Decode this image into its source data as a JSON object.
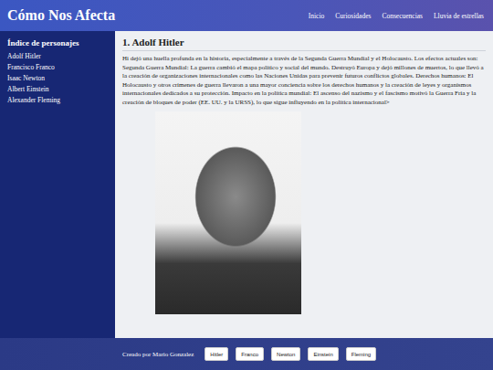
{
  "header": {
    "title": "Cómo Nos Afecta",
    "nav": [
      "Inicio",
      "Curiosidades",
      "Consecuencias",
      "Lluvia de estrellas"
    ]
  },
  "sidebar": {
    "heading": "Índice de personajes",
    "items": [
      "Adolf Hitler",
      "Francisco Franco",
      "Isaac Newton",
      "Albert Einstein",
      "Alexander Fleming"
    ]
  },
  "main": {
    "heading": "1. Adolf Hitler",
    "text": "Hi dejó una huella profunda en la historia, especialmente a través de la Segunda Guerra Mundial y el Holocausto. Los efectos actuales son: Segunda Guerra Mundial: La guerra cambió el mapa político y social del mundo. Destruyó Europa y dejó millones de muertos, lo que llevó a la creación de organizaciones internacionales como las Naciones Unidas para prevenir futuros conflictos globales. Derechos humanos: El Holocausto y otros crímenes de guerra llevaron a una mayor conciencia sobre los derechos humanos y la creación de leyes y organismos internacionales dedicados a su protección. Impacto en la política mundial: El ascenso del nazismo y el fascismo motivó la Guerra Fría y la creación de bloques de poder (EE. UU. y la URSS), lo que sigue influyendo en la política internacional>"
  },
  "footer": {
    "credit": "Creado por Mario Gonzalez",
    "buttons": [
      "Hitler",
      "Franco",
      "Newton",
      "Einstein",
      "Fleming"
    ]
  }
}
